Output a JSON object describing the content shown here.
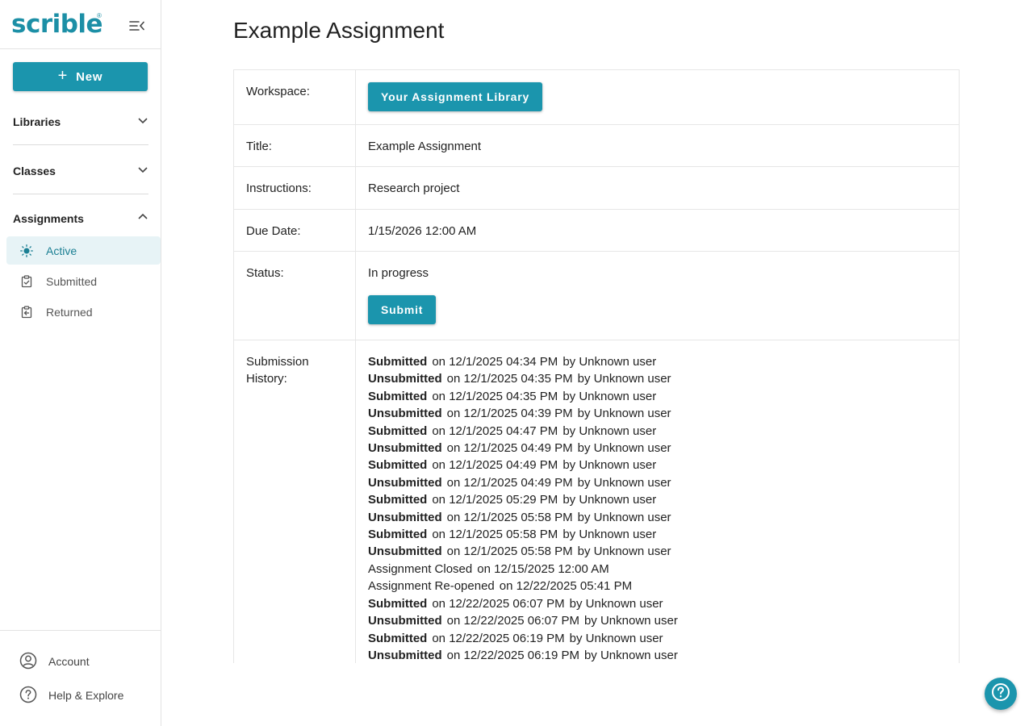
{
  "brand": {
    "name": "scrible",
    "reg": "®"
  },
  "sidebar": {
    "new_label": "New",
    "sections": [
      {
        "label": "Libraries"
      },
      {
        "label": "Classes"
      },
      {
        "label": "Assignments"
      }
    ],
    "assignment_items": [
      {
        "label": "Active",
        "icon": "sun-icon",
        "active": true
      },
      {
        "label": "Submitted",
        "icon": "clipboard-check-icon",
        "active": false
      },
      {
        "label": "Returned",
        "icon": "clipboard-return-icon",
        "active": false
      }
    ],
    "bottom": [
      {
        "label": "Account",
        "icon": "account-icon"
      },
      {
        "label": "Help & Explore",
        "icon": "help-icon"
      }
    ]
  },
  "main": {
    "title": "Example Assignment",
    "labels": {
      "workspace": "Workspace:",
      "title": "Title:",
      "instructions": "Instructions:",
      "due": "Due Date:",
      "status": "Status:",
      "history_1": "Submission",
      "history_2": "History:"
    },
    "workspace_button": "Your Assignment Library",
    "title_value": "Example Assignment",
    "instructions_value": "Research project",
    "due_value": "1/15/2026 12:00 AM",
    "status_value": "In progress",
    "submit_button": "Submit",
    "history": [
      {
        "action": "Submitted",
        "bold": true,
        "when": "on 12/1/2025 04:34 PM",
        "by": "by Unknown user"
      },
      {
        "action": "Unsubmitted",
        "bold": true,
        "when": "on 12/1/2025 04:35 PM",
        "by": "by Unknown user"
      },
      {
        "action": "Submitted",
        "bold": true,
        "when": "on 12/1/2025 04:35 PM",
        "by": "by Unknown user"
      },
      {
        "action": "Unsubmitted",
        "bold": true,
        "when": "on 12/1/2025 04:39 PM",
        "by": "by Unknown user"
      },
      {
        "action": "Submitted",
        "bold": true,
        "when": "on 12/1/2025 04:47 PM",
        "by": "by Unknown user"
      },
      {
        "action": "Unsubmitted",
        "bold": true,
        "when": "on 12/1/2025 04:49 PM",
        "by": "by Unknown user"
      },
      {
        "action": "Submitted",
        "bold": true,
        "when": "on 12/1/2025 04:49 PM",
        "by": "by Unknown user"
      },
      {
        "action": "Unsubmitted",
        "bold": true,
        "when": "on 12/1/2025 04:49 PM",
        "by": "by Unknown user"
      },
      {
        "action": "Submitted",
        "bold": true,
        "when": "on 12/1/2025 05:29 PM",
        "by": "by Unknown user"
      },
      {
        "action": "Unsubmitted",
        "bold": true,
        "when": "on 12/1/2025 05:58 PM",
        "by": "by Unknown user"
      },
      {
        "action": "Submitted",
        "bold": true,
        "when": "on 12/1/2025 05:58 PM",
        "by": "by Unknown user"
      },
      {
        "action": "Unsubmitted",
        "bold": true,
        "when": "on 12/1/2025 05:58 PM",
        "by": "by Unknown user"
      },
      {
        "action": "Assignment Closed",
        "bold": false,
        "when": "on 12/15/2025 12:00 AM",
        "by": ""
      },
      {
        "action": "Assignment Re-opened",
        "bold": false,
        "when": "on 12/22/2025 05:41 PM",
        "by": ""
      },
      {
        "action": "Submitted",
        "bold": true,
        "when": "on 12/22/2025 06:07 PM",
        "by": "by Unknown user"
      },
      {
        "action": "Unsubmitted",
        "bold": true,
        "when": "on 12/22/2025 06:07 PM",
        "by": "by Unknown user"
      },
      {
        "action": "Submitted",
        "bold": true,
        "when": "on 12/22/2025 06:19 PM",
        "by": "by Unknown user"
      },
      {
        "action": "Unsubmitted",
        "bold": true,
        "when": "on 12/22/2025 06:19 PM",
        "by": "by Unknown user"
      }
    ]
  },
  "help_fab_icon": "help-icon",
  "colors": {
    "accent": "#1b95ad",
    "active_bg": "#e7f3f6",
    "active_text": "#1b7f93"
  }
}
